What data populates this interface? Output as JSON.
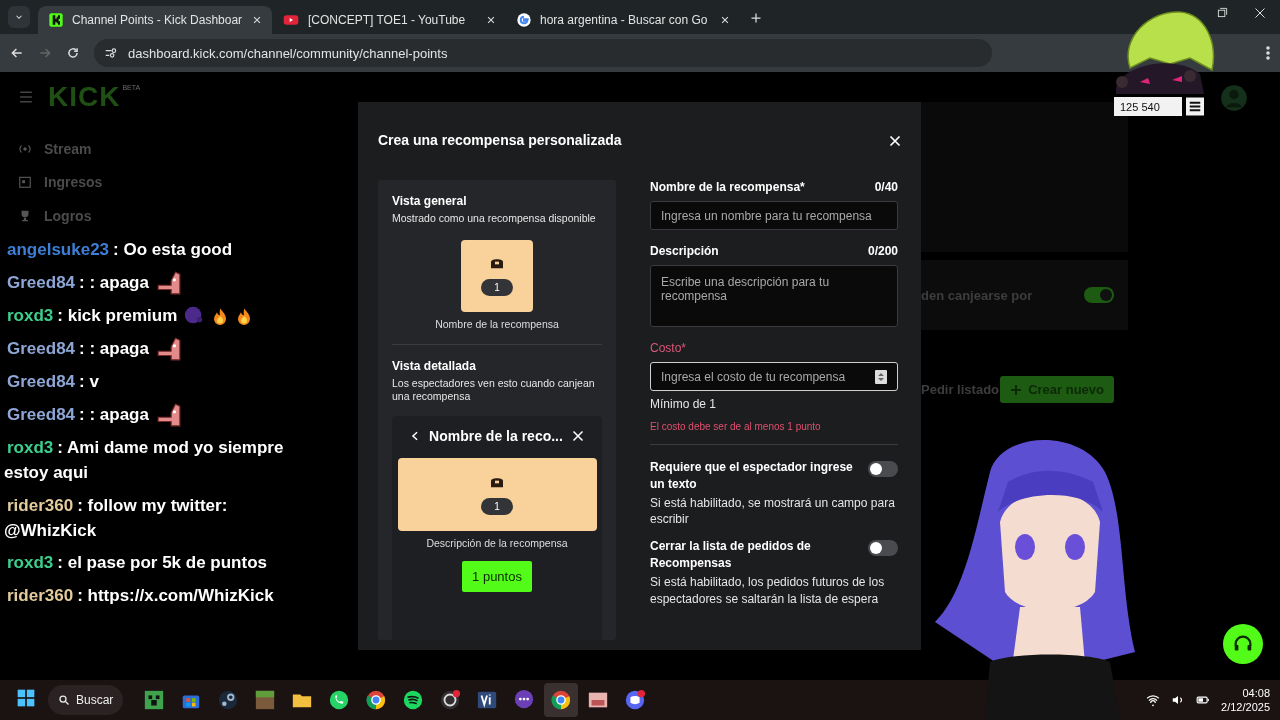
{
  "browser": {
    "tabs": [
      {
        "title": "Channel Points - Kick Dashboar",
        "kind": "kick",
        "selected": true
      },
      {
        "title": "[CONCEPT] TOE1 - YouTube",
        "kind": "youtube",
        "selected": false
      },
      {
        "title": "hora argentina - Buscar con Go",
        "kind": "google",
        "selected": false
      }
    ],
    "url": "dashboard.kick.com/channel/community/channel-points"
  },
  "dashboard": {
    "logo": "KICK",
    "logo_badge": "BETA",
    "sidebar_groups": [
      {
        "items": [
          {
            "label": "Stream",
            "kind": "stream"
          },
          {
            "label": "Ingresos",
            "kind": "income"
          },
          {
            "label": "Logros",
            "kind": "trophy"
          }
        ]
      }
    ],
    "reward_setting": {
      "text": "den canjearse por",
      "on": true
    },
    "request_listing": "Pedir listado",
    "create_button": "Crear nuevo"
  },
  "modal": {
    "title": "Crea una recompensa personalizada",
    "overview": {
      "title": "Vista general",
      "subtitle": "Mostrado como una recompensa disponible",
      "cost": "1",
      "name": "Nombre de la recompensa"
    },
    "detail": {
      "title": "Vista detallada",
      "subtitle": "Los espectadores ven esto cuando canjean una recompensa",
      "header": "Nombre de la reco...",
      "cost": "1",
      "description": "Descripción de la recompensa",
      "button": "1 puntos"
    },
    "fields": [
      {
        "label": "Nombre de la recompensa*",
        "counter": "0/40",
        "placeholder": "Ingresa un nombre para tu recompensa",
        "kind": "text",
        "focused": false,
        "error": false
      },
      {
        "label": "Descripción",
        "counter": "0/200",
        "placeholder": "Escribe una descripción para tu recompensa",
        "kind": "textarea",
        "focused": false,
        "error": false
      },
      {
        "label": "Costo*",
        "placeholder": "Ingresa el costo de tu recompensa",
        "kind": "number",
        "focused": true,
        "error": true,
        "hint": "Mínimo de 1",
        "error_text": "El costo debe ser de al menos 1 punto"
      }
    ],
    "toggles": [
      {
        "title": "Requiere que el espectador ingrese un texto",
        "description": "Si está habilitado, se mostrará un campo para escribir",
        "on": false
      },
      {
        "title": "Cerrar la lista de pedidos de Recompensas",
        "description": "Si está habilitado, los pedidos futuros de los espectadores se saltarán la lista de espera",
        "on": false
      }
    ]
  },
  "chat": [
    {
      "user": "angelsuke23",
      "color": "#3d7fd6",
      "message": ": Oo esta good"
    },
    {
      "user": "Greed84",
      "color": "#8ea6d6",
      "message": ": : apaga"
    },
    {
      "user": "roxd3",
      "color": "#3ccf8e",
      "message": ": kick premium"
    },
    {
      "user": "Greed84",
      "color": "#8ea6d6",
      "message": ": : apaga"
    },
    {
      "user": "Greed84",
      "color": "#8ea6d6",
      "message": ": v"
    },
    {
      "user": "Greed84",
      "color": "#8ea6d6",
      "message": ": : apaga"
    },
    {
      "user": "roxd3",
      "color": "#3ccf8e",
      "message": ": Ami dame mod yo siempre estoy aqui"
    },
    {
      "user": "rider360",
      "color": "#e3cb9c",
      "message": ": follow my twitter: @WhizKick"
    },
    {
      "user": "roxd3",
      "color": "#3ccf8e",
      "message": ": el pase por 5k de puntos"
    },
    {
      "user": "rider360",
      "color": "#e3cb9c",
      "message": ": https://x.com/WhizKick"
    }
  ],
  "overlay": {
    "counter": "125 540"
  },
  "taskbar": {
    "search": "Buscar",
    "time": "04:08",
    "date": "2/12/2025",
    "apps": [
      {
        "selected": false
      },
      {
        "selected": false
      },
      {
        "selected": false
      },
      {
        "selected": false
      },
      {
        "selected": false
      },
      {
        "selected": false
      },
      {
        "selected": false
      },
      {
        "selected": false
      },
      {
        "selected": false
      },
      {
        "selected": false
      },
      {
        "selected": false
      },
      {
        "selected": true
      },
      {
        "selected": false
      },
      {
        "selected": false
      }
    ]
  }
}
